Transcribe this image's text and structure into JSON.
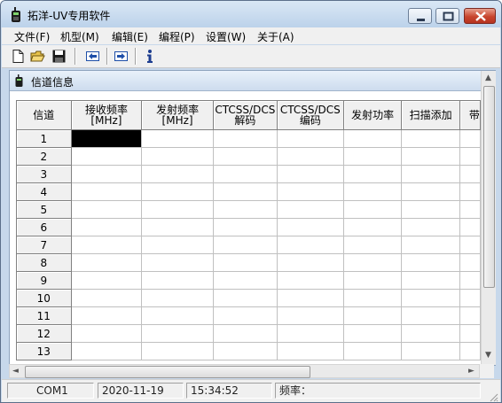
{
  "window": {
    "title": "拓洋-UV专用软件"
  },
  "menu": [
    {
      "label": "文件(F)"
    },
    {
      "label": "机型(M)"
    },
    {
      "label": "编辑(E)"
    },
    {
      "label": "编程(P)"
    },
    {
      "label": "设置(W)"
    },
    {
      "label": "关于(A)"
    }
  ],
  "toolbar": {
    "icons": [
      "new-file-icon",
      "open-folder-icon",
      "save-disk-icon",
      "read-from-radio-icon",
      "write-to-radio-icon",
      "info-icon"
    ]
  },
  "panel": {
    "title": "信道信息"
  },
  "table": {
    "headers": [
      {
        "line1": "信道",
        "line2": ""
      },
      {
        "line1": "接收频率",
        "line2": "[MHz]"
      },
      {
        "line1": "发射频率",
        "line2": "[MHz]"
      },
      {
        "line1": "CTCSS/DCS",
        "line2": "解码"
      },
      {
        "line1": "CTCSS/DCS",
        "line2": "编码"
      },
      {
        "line1": "发射功率",
        "line2": ""
      },
      {
        "line1": "扫描添加",
        "line2": ""
      },
      {
        "line1": "带",
        "line2": ""
      }
    ],
    "rows": [
      "1",
      "2",
      "3",
      "4",
      "5",
      "6",
      "7",
      "8",
      "9",
      "10",
      "11",
      "12",
      "13"
    ],
    "selected_cell": {
      "row": 1,
      "column": "接收频率"
    }
  },
  "status": {
    "port": "COM1",
    "date": "2020-11-19",
    "time": "15:34:52",
    "frequency_label": "频率："
  },
  "colors": {
    "titlebar": "#c7d8eb",
    "close_button": "#c8462f",
    "toolbar_arrows": "#1f4fa8"
  }
}
